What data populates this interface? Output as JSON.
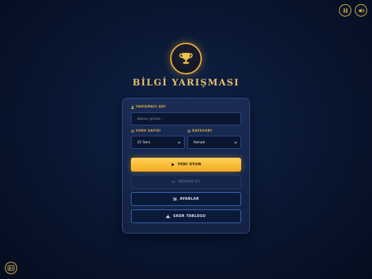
{
  "header": {
    "pause_icon": "pause-icon",
    "sound_icon": "volume-icon",
    "logo_icon": "trophy-icon",
    "title": "BİLGİ YARIŞMASI"
  },
  "form": {
    "name_label": "YARIŞMACI ADI",
    "name_placeholder": "Adınızı giriniz...",
    "count_label": "SORU SAYISI",
    "count_value": "15 Soru",
    "category_label": "KATEGORİ",
    "category_value": "Karışık"
  },
  "buttons": {
    "new_game": "YENİ OYUN",
    "continue": "DEVAM ET",
    "settings": "AYARLAR",
    "scoreboard": "SKOR TABLOSU"
  },
  "footer": {
    "corner_icon": "id-card-icon"
  },
  "colors": {
    "accent": "#e8a93a",
    "primary_button": "#f2ac1e",
    "background": "#0a1834"
  }
}
